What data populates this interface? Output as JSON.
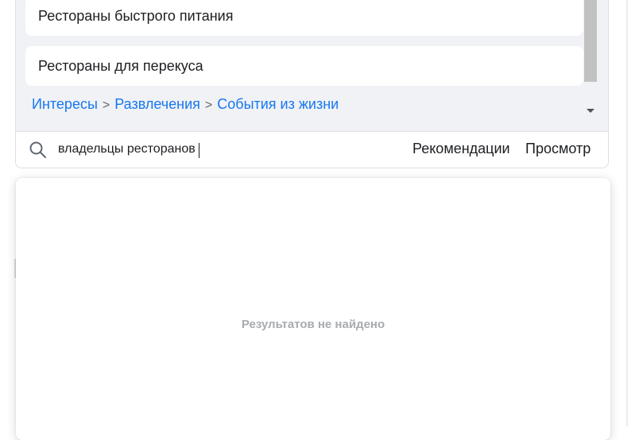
{
  "list": {
    "items": [
      {
        "label": "Рестораны быстрого питания"
      },
      {
        "label": "Рестораны для перекуса"
      }
    ],
    "breadcrumb": [
      {
        "label": "Интересы"
      },
      {
        "label": "Развлечения"
      },
      {
        "label": "События из жизни"
      }
    ],
    "breadcrumb_separator": ">"
  },
  "search": {
    "value": "владельцы ресторанов",
    "recommendations_label": "Рекомендации",
    "browse_label": "Просмотр"
  },
  "results": {
    "empty_message": "Результатов не найдено"
  },
  "icons": {
    "search": "search-icon",
    "scroll_down": "scroll-down-arrow-icon"
  },
  "colors": {
    "link": "#1877f2",
    "muted": "#a8abaf"
  }
}
